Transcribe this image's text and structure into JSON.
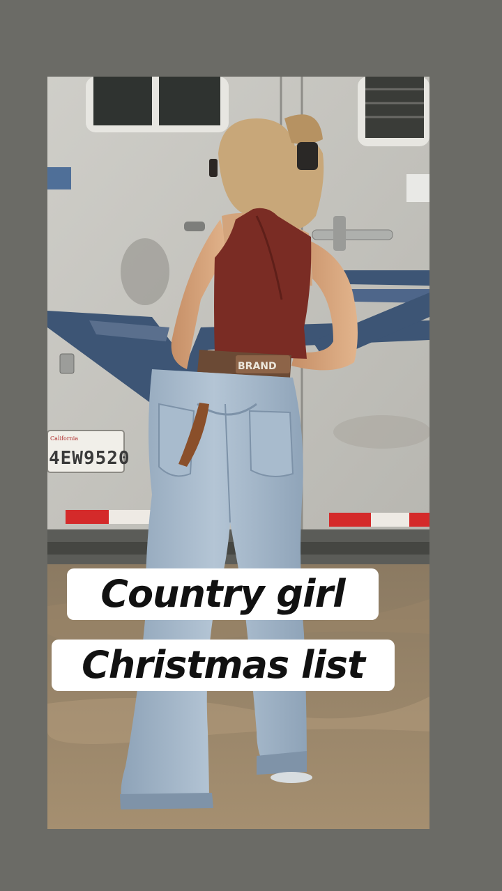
{
  "story": {
    "caption_lines": [
      "Country girl",
      "Christmas list"
    ]
  },
  "photo": {
    "license_plate_text": "4EW9520",
    "belt_text": "BRAND"
  },
  "colors": {
    "background": "#6b6b66",
    "caption_background": "#ffffff",
    "caption_text": "#111111",
    "tank_top": "#7a2c24",
    "jeans": "#9fb3c8",
    "trailer": "#c9c8c3",
    "trailer_stripe": "#3d5575"
  }
}
